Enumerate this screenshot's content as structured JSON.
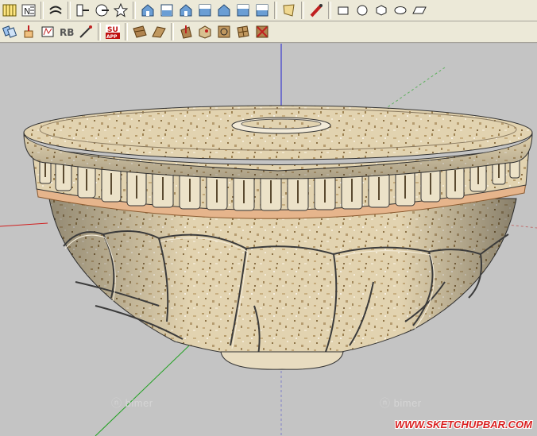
{
  "toolbars": {
    "row1": [
      "layers-icon",
      "ne-axis-icon",
      "curve-icon",
      "section-plane-icon",
      "sphere-icon",
      "star-icon",
      "iso-house-icon",
      "top-house-icon",
      "front-house-icon",
      "right-house-icon",
      "back-house-icon",
      "left-house-icon",
      "bottom-house-icon",
      "paper-icon",
      "paint-bucket-icon",
      "rectangle-icon",
      "circle-icon",
      "polygon-icon",
      "ellipse-icon",
      "parallelogram-icon"
    ],
    "row2": [
      "lasso-icon",
      "push-pull-icon",
      "shape-icon",
      "rb-icon",
      "wand-icon",
      "su-app-icon",
      "surface-icon",
      "flat-surface-icon",
      "arrow-up-icon",
      "box-icon",
      "circle-frame-icon",
      "grid-icon",
      "red-x-icon"
    ]
  },
  "badges": {
    "su_top": "SU",
    "su_bottom": "APP",
    "rb": "RB",
    "ne": "N"
  },
  "viewport": {
    "watermarks": [
      "bimer",
      "bimer"
    ],
    "site_banner": "WWW.SKETCHUPBAR.COM"
  },
  "colors": {
    "toolbar_bg": "#ece9d8",
    "viewport_bg": "#c4c4c4",
    "axis_blue": "#2020d0",
    "axis_red": "#d02020",
    "axis_green": "#20a020",
    "banner_red": "#d92020"
  }
}
